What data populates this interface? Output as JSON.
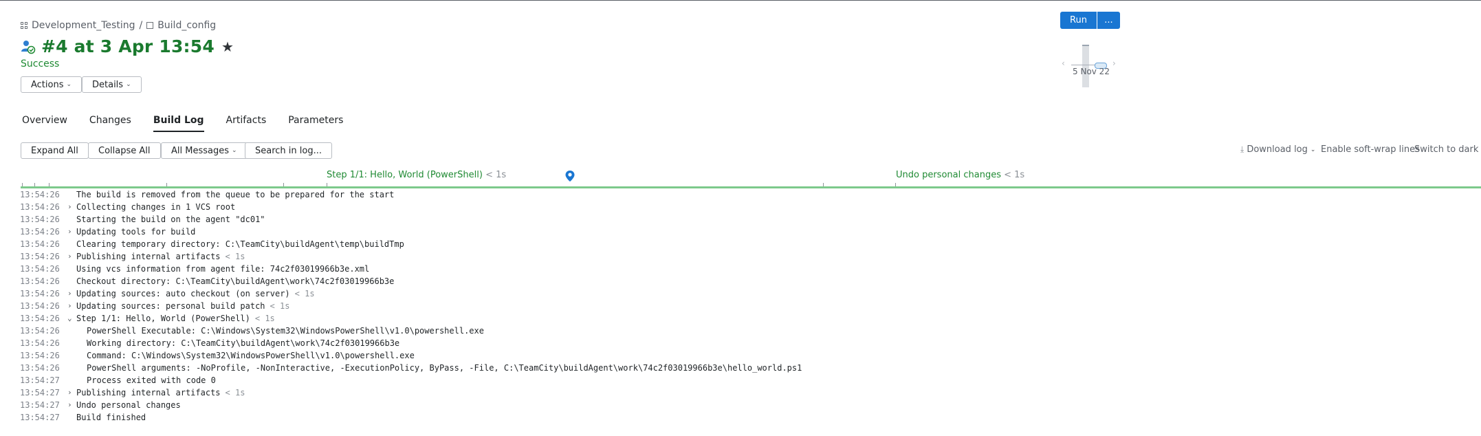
{
  "breadcrumb": {
    "project": "Development_Testing",
    "separator": "/",
    "config": "Build_config"
  },
  "build": {
    "title": "#4 at 3 Apr 13:54",
    "status": "Success"
  },
  "buttons": {
    "actions": "Actions",
    "details": "Details",
    "run": "Run",
    "more": "..."
  },
  "mini_timeline": {
    "date": "5 Nov 22",
    "prev": "‹",
    "next": "›"
  },
  "tabs": [
    {
      "label": "Overview"
    },
    {
      "label": "Changes"
    },
    {
      "label": "Build Log"
    },
    {
      "label": "Artifacts"
    },
    {
      "label": "Parameters"
    }
  ],
  "toolbar": {
    "expand_all": "Expand All",
    "collapse_all": "Collapse All",
    "all_messages": "All Messages",
    "search": "Search in log...",
    "download_log": "Download log",
    "soft_wrap": "Enable soft-wrap lines",
    "dark_mode": "Switch to dark mo"
  },
  "steps": [
    {
      "name": "Step 1/1: Hello, World (PowerShell)",
      "duration": "< 1s"
    },
    {
      "name": "Undo personal changes",
      "duration": "< 1s"
    }
  ],
  "colors": {
    "accent": "#1976d2",
    "success": "#1f8a33",
    "title": "#1a7a2e"
  },
  "log": [
    {
      "time": "13:54:26",
      "expand": "",
      "text": "The build is removed from the queue to be prepared for the start",
      "dur": ""
    },
    {
      "time": "13:54:26",
      "expand": "›",
      "text": "Collecting changes in 1 VCS root",
      "dur": ""
    },
    {
      "time": "13:54:26",
      "expand": "",
      "text": "Starting the build on the agent \"dc01\"",
      "dur": ""
    },
    {
      "time": "13:54:26",
      "expand": "›",
      "text": "Updating tools for build",
      "dur": ""
    },
    {
      "time": "13:54:26",
      "expand": "",
      "text": "Clearing temporary directory: C:\\TeamCity\\buildAgent\\temp\\buildTmp",
      "dur": ""
    },
    {
      "time": "13:54:26",
      "expand": "›",
      "text": "Publishing internal artifacts",
      "dur": "< 1s"
    },
    {
      "time": "13:54:26",
      "expand": "",
      "text": "Using vcs information from agent file: 74c2f03019966b3e.xml",
      "dur": ""
    },
    {
      "time": "13:54:26",
      "expand": "",
      "text": "Checkout directory: C:\\TeamCity\\buildAgent\\work\\74c2f03019966b3e",
      "dur": ""
    },
    {
      "time": "13:54:26",
      "expand": "›",
      "text": "Updating sources: auto checkout (on server)",
      "dur": "< 1s"
    },
    {
      "time": "13:54:26",
      "expand": "›",
      "text": "Updating sources: personal build patch",
      "dur": "< 1s"
    },
    {
      "time": "13:54:26",
      "expand": "⌄",
      "text": "Step 1/1: Hello, World (PowerShell)",
      "dur": "< 1s"
    },
    {
      "time": "13:54:26",
      "expand": "",
      "indent": true,
      "text": "PowerShell Executable: C:\\Windows\\System32\\WindowsPowerShell\\v1.0\\powershell.exe",
      "dur": ""
    },
    {
      "time": "13:54:26",
      "expand": "",
      "indent": true,
      "text": "Working directory: C:\\TeamCity\\buildAgent\\work\\74c2f03019966b3e",
      "dur": ""
    },
    {
      "time": "13:54:26",
      "expand": "",
      "indent": true,
      "text": "Command: C:\\Windows\\System32\\WindowsPowerShell\\v1.0\\powershell.exe",
      "dur": ""
    },
    {
      "time": "13:54:26",
      "expand": "",
      "indent": true,
      "text": "PowerShell arguments: -NoProfile, -NonInteractive, -ExecutionPolicy, ByPass, -File, C:\\TeamCity\\buildAgent\\work\\74c2f03019966b3e\\hello_world.ps1",
      "dur": ""
    },
    {
      "time": "13:54:27",
      "expand": "",
      "indent": true,
      "text": "Process exited with code 0",
      "dur": ""
    },
    {
      "time": "13:54:27",
      "expand": "›",
      "text": "Publishing internal artifacts",
      "dur": "< 1s"
    },
    {
      "time": "13:54:27",
      "expand": "›",
      "text": "Undo personal changes",
      "dur": ""
    },
    {
      "time": "13:54:27",
      "expand": "",
      "text": "Build finished",
      "dur": ""
    }
  ]
}
